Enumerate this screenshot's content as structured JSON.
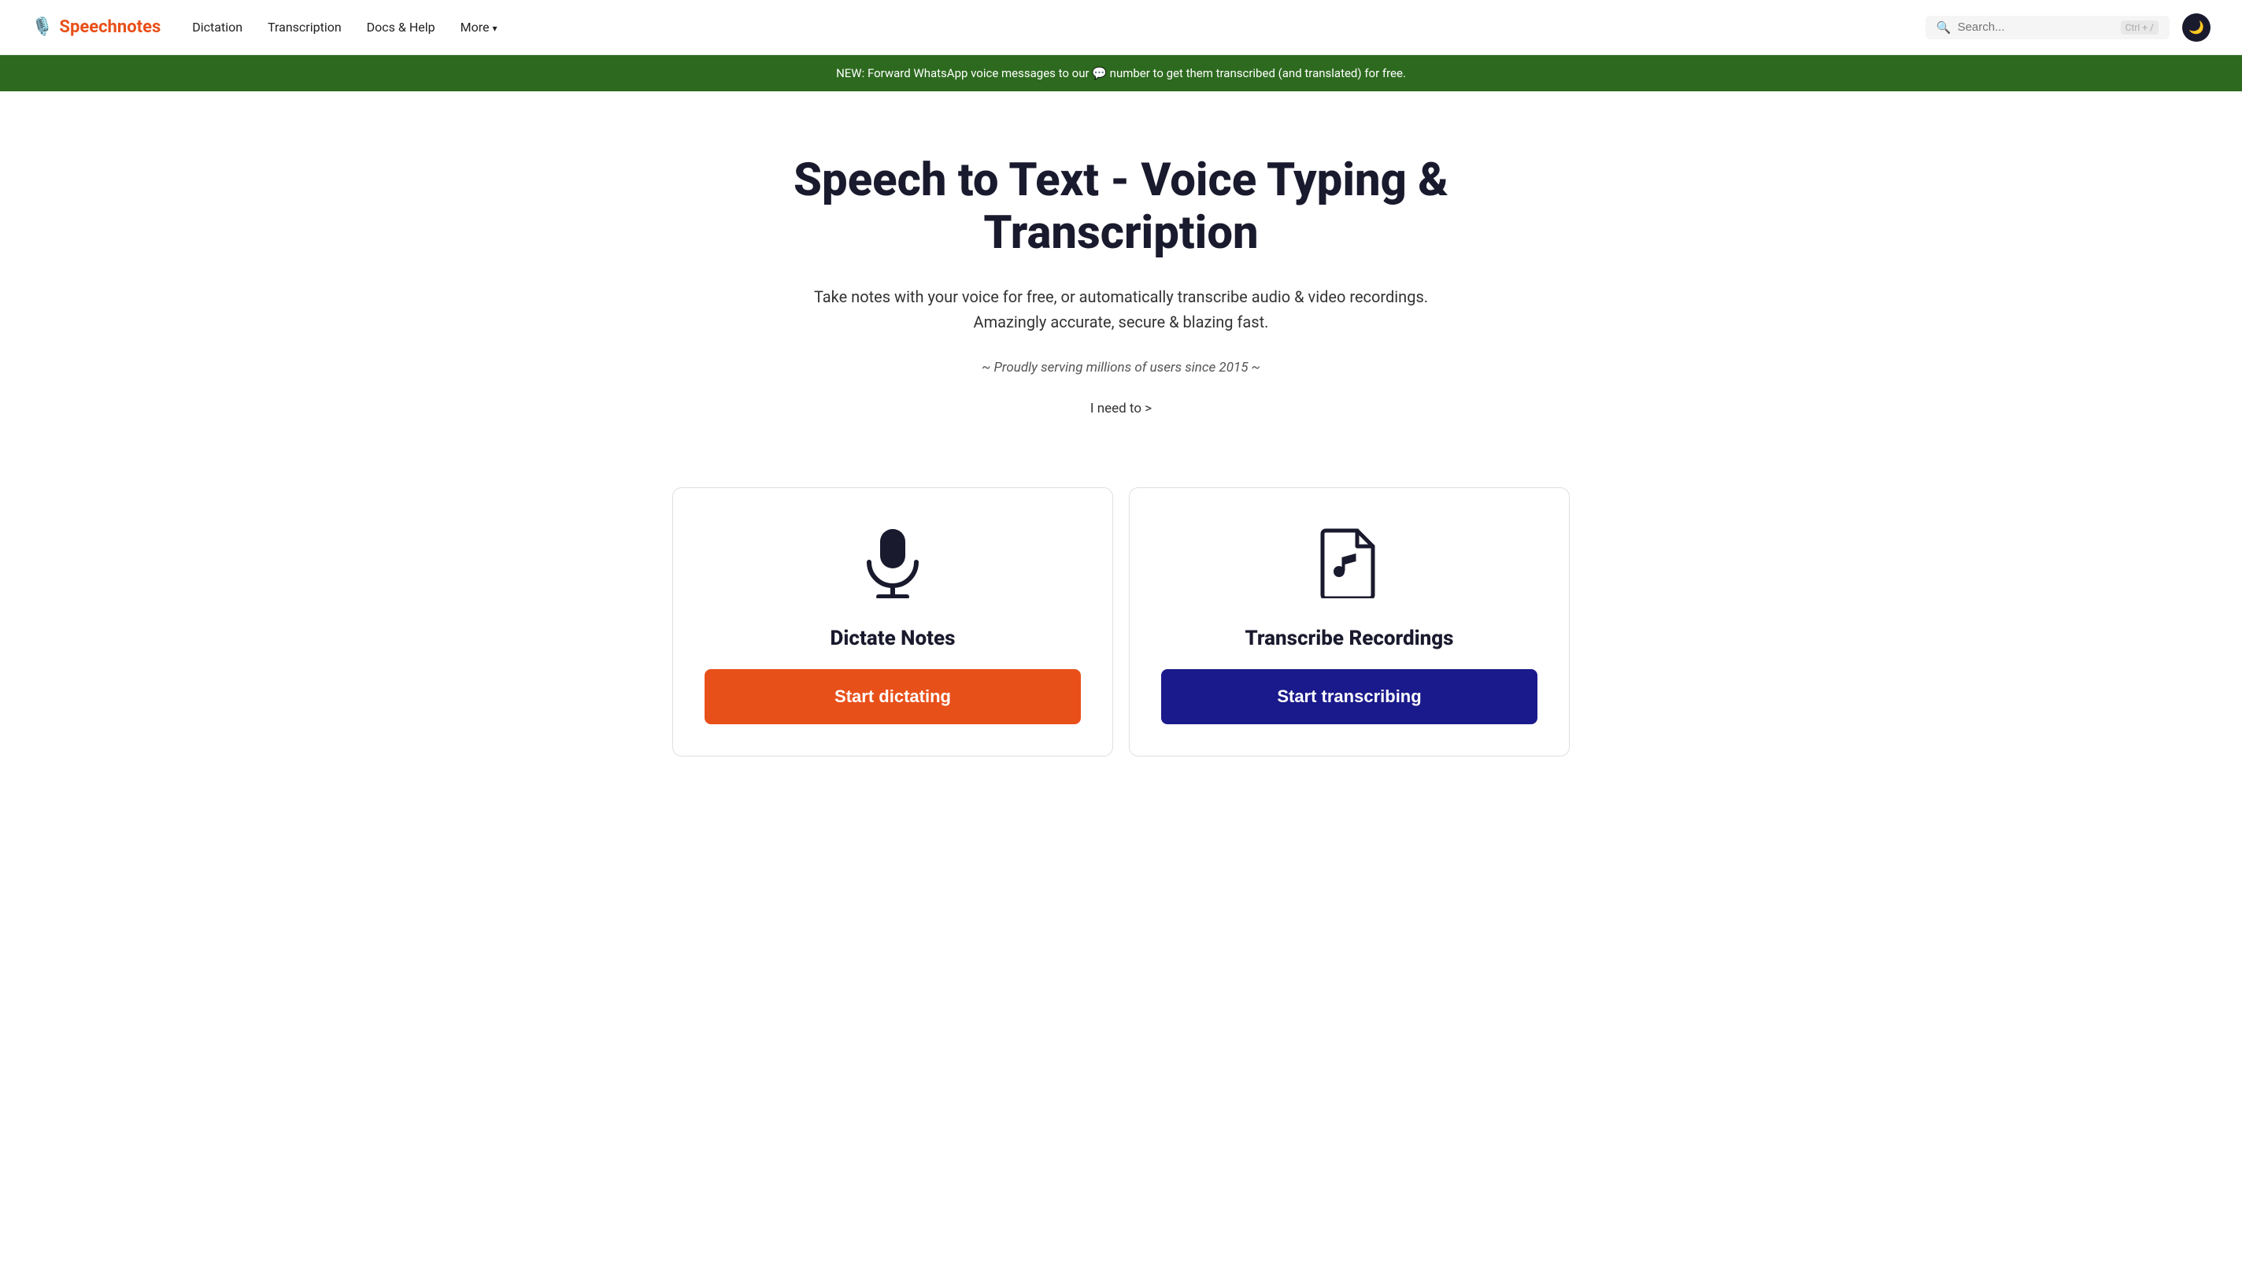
{
  "navbar": {
    "logo_icon": "🎙️",
    "logo_text": "Speechnotes",
    "links": [
      {
        "id": "dictation",
        "label": "Dictation"
      },
      {
        "id": "transcription",
        "label": "Transcription"
      },
      {
        "id": "docs",
        "label": "Docs & Help"
      },
      {
        "id": "more",
        "label": "More"
      }
    ],
    "search_placeholder": "Search...",
    "kbd_shortcut": "Ctrl + /",
    "dark_toggle_icon": "🌙"
  },
  "banner": {
    "text": "NEW: Forward WhatsApp voice messages to our 💬 number to get them transcribed (and translated) for free."
  },
  "hero": {
    "title_line1": "Speech to Text - Voice Typing &",
    "title_line2": "Transcription",
    "subtitle_line1": "Take notes with your voice for free, or automatically transcribe audio & video recordings.",
    "subtitle_line2": "Amazingly accurate, secure & blazing fast.",
    "tagline": "~ Proudly serving millions of users since 2015 ~",
    "i_need_to": "I need to >"
  },
  "cards": [
    {
      "id": "dictate",
      "icon_name": "microphone-icon",
      "title": "Dictate Notes",
      "button_label": "Start dictating",
      "button_style": "dictate"
    },
    {
      "id": "transcribe",
      "icon_name": "audio-file-icon",
      "title": "Transcribe Recordings",
      "button_label": "Start transcribing",
      "button_style": "transcribe"
    }
  ],
  "colors": {
    "accent_orange": "#e8501a",
    "accent_dark_blue": "#1a1a8c",
    "banner_green": "#2d6a1f",
    "logo_orange": "#e8501a"
  }
}
